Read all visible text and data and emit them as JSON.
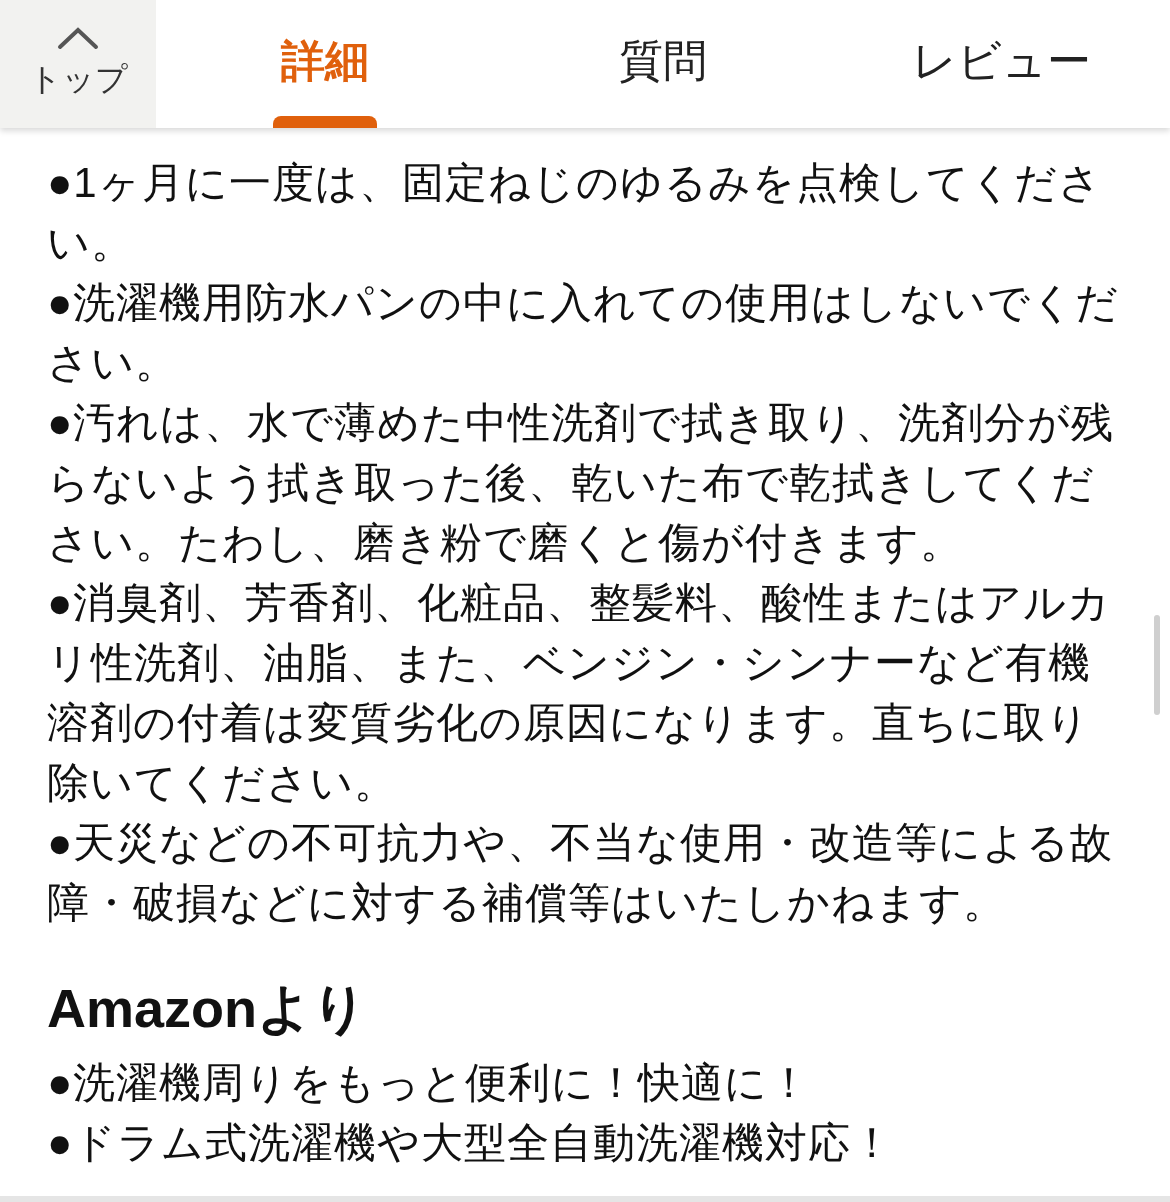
{
  "header": {
    "top_button": {
      "label": "トップ"
    },
    "tabs": [
      {
        "label": "詳細",
        "selected": true
      },
      {
        "label": "質問",
        "selected": false
      },
      {
        "label": "レビュー",
        "selected": false
      }
    ]
  },
  "notes": [
    "●1ヶ月に一度は、固定ねじのゆるみを点検してください。",
    "●洗濯機用防水パンの中に入れての使用はしないでください。",
    "●汚れは、水で薄めた中性洗剤で拭き取り、洗剤分が残らないよう拭き取った後、乾いた布で乾拭きしてください。たわし、磨き粉で磨くと傷が付きます。",
    "●消臭剤、芳香剤、化粧品、整髪料、酸性またはアルカリ性洗剤、油脂、また、ベンジン・シンナーなど有機溶剤の付着は変質劣化の原因になります。直ちに取り除いてください。",
    "●天災などの不可抗力や、不当な使用・改造等による故障・破損などに対する補償等はいたしかねます。"
  ],
  "section": {
    "heading": "Amazonより",
    "items": [
      "●洗濯機周りをもっと便利に！快適に！",
      "●ドラム式洗濯機や大型全自動洗濯機対応！"
    ]
  }
}
